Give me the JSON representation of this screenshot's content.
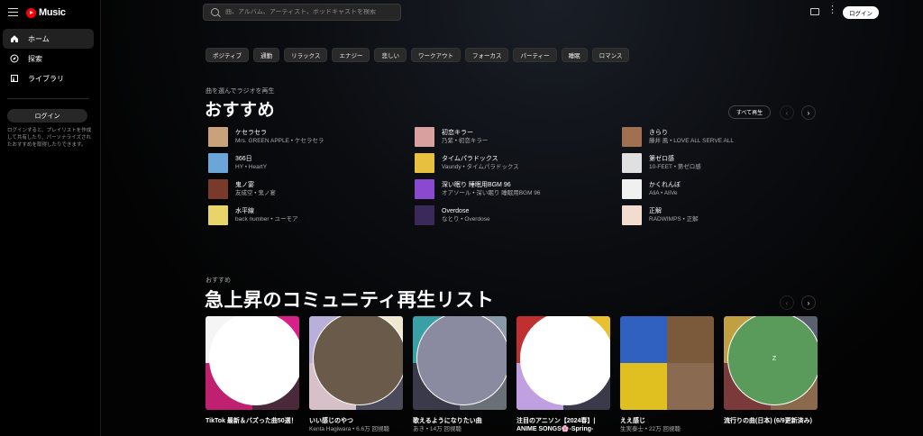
{
  "app": {
    "logo_text": "Music"
  },
  "sidebar": {
    "items": [
      {
        "label": "ホーム",
        "icon": "home-icon"
      },
      {
        "label": "探索",
        "icon": "compass-icon"
      },
      {
        "label": "ライブラリ",
        "icon": "library-icon"
      }
    ],
    "login_label": "ログイン",
    "note": "ログインすると、プレイリストを作成して共有したり、パーソナライズされたおすすめを取得したりできます。"
  },
  "header": {
    "search_placeholder": "曲、アルバム、アーティスト、ポッドキャストを検索",
    "login_label": "ログイン",
    "more": "⋮"
  },
  "chips": [
    "ポジティブ",
    "通勤",
    "リラックス",
    "エナジー",
    "悲しい",
    "ワークアウト",
    "フォーカス",
    "パーティー",
    "睡眠",
    "ロマンス"
  ],
  "section1": {
    "subtitle": "曲を選んでラジオを再生",
    "title": "おすすめ",
    "play_all": "すべて再生",
    "prev": "‹",
    "next": "›",
    "songs": [
      {
        "title": "ケセラセラ",
        "meta": "Mrs. GREEN APPLE • ケセラセラ",
        "color": "#c9a27a"
      },
      {
        "title": "366日",
        "meta": "HY • HeartY",
        "color": "#6aa6d8"
      },
      {
        "title": "鬼ノ宴",
        "meta": "友成空 • 鬼ノ宴",
        "color": "#7a3a2a"
      },
      {
        "title": "水平線",
        "meta": "back number • ユーモア",
        "color": "#e8d56a"
      },
      {
        "title": "初恋キラー",
        "meta": "乃紫 • 初恋キラー",
        "color": "#d9a0a0"
      },
      {
        "title": "タイムパラドックス",
        "meta": "Vaundy • タイムパラドックス",
        "color": "#e8c040"
      },
      {
        "title": "深い眠り 睡眠用BGM 96",
        "meta": "オアソール • 深い眠り 睡眠用BGM 96",
        "color": "#8a4ad0"
      },
      {
        "title": "Overdose",
        "meta": "なとり • Overdose",
        "color": "#3a2a5a"
      },
      {
        "title": "きらり",
        "meta": "藤井 風 • LOVE ALL SERVE ALL",
        "color": "#a07050"
      },
      {
        "title": "第ゼロ感",
        "meta": "10-FEET • 第ゼロ感",
        "color": "#e0e0e0"
      },
      {
        "title": "かくれんぼ",
        "meta": "AliA • AliVe",
        "color": "#f0f0f0"
      },
      {
        "title": "正解",
        "meta": "RADWIMPS • 正解",
        "color": "#f2dcd0"
      }
    ]
  },
  "section2": {
    "subtitle": "おすすめ",
    "title": "急上昇のコミュニティ再生リスト",
    "prev": "‹",
    "next": "›",
    "cards": [
      {
        "title": "TikTok 最新＆バズった曲50選！",
        "meta": "",
        "avatar": "",
        "colors": [
          "#f5f5f5",
          "#d8208a",
          "#c02070",
          "#4a2a3a"
        ]
      },
      {
        "title": "いい感じのやつ",
        "meta": "Kenta Hagiwara • 6.6万 回視聴",
        "avatar": "",
        "colors": [
          "#b8b0d8",
          "#f0e8d0",
          "#d8c0c8",
          "#4a4a5a"
        ]
      },
      {
        "title": "歌えるようになりたい曲",
        "meta": "あき • 14万 回視聴",
        "avatar": "",
        "colors": [
          "#3aa0a8",
          "#8a9aa8",
          "#3a3a4a",
          "#6a7078"
        ]
      },
      {
        "title": "注目のアニソン【2024春】| ANIME SONGS🌸-Spring-",
        "meta": "",
        "avatar": "",
        "colors": [
          "#c03030",
          "#e8c030",
          "#c0a0e0",
          "#3a3a4a"
        ]
      },
      {
        "title": "ええ感じ",
        "meta": "生実泰士 • 22万 回視聴",
        "avatar": "",
        "colors": [
          "#3060c0",
          "#7a5a3a",
          "#e0c020",
          "#8a6a50"
        ]
      },
      {
        "title": "流行りの曲(日本) (6/9更新済み)",
        "meta": "",
        "avatar": "Z",
        "colors": [
          "#c0a040",
          "#5a6070",
          "#7a3a3a",
          "#8a6a4a"
        ]
      }
    ]
  }
}
